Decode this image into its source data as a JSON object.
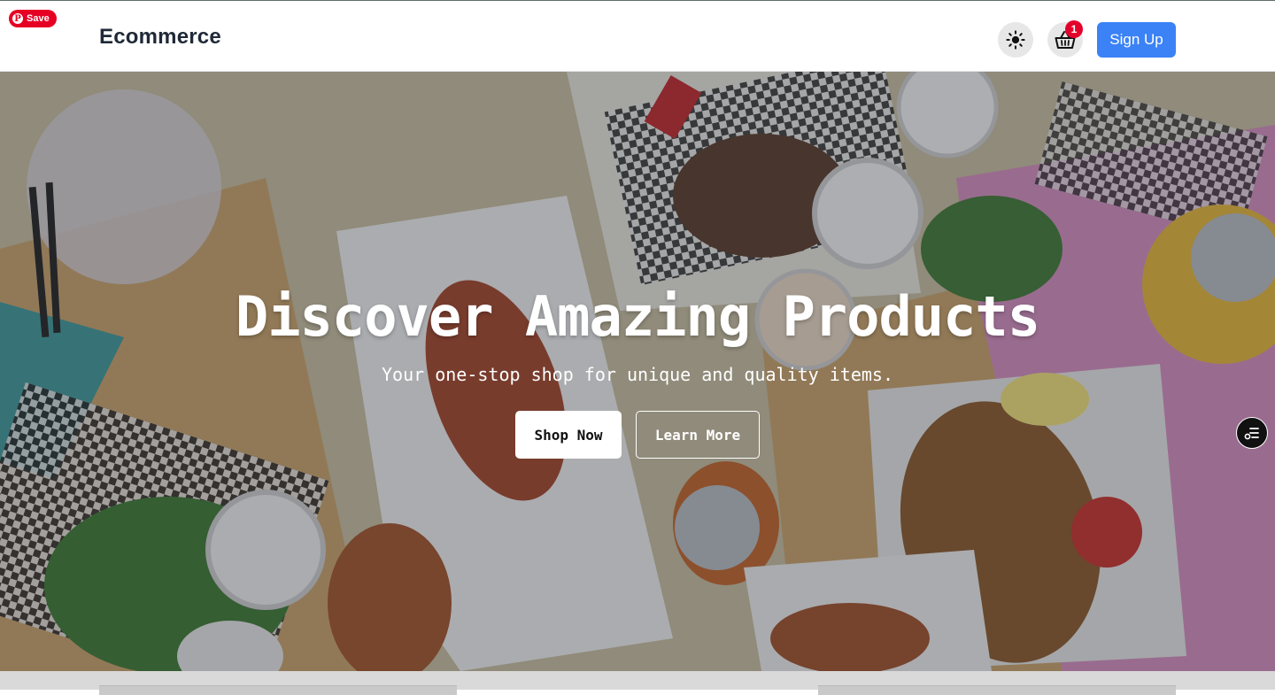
{
  "pinterest": {
    "save_label": "Save",
    "logo": "P"
  },
  "header": {
    "brand": "Ecommerce",
    "theme_toggle_icon": "sun-icon",
    "cart_icon": "basket-icon",
    "cart_count": "1",
    "signup_label": "Sign Up"
  },
  "hero": {
    "title": "Discover Amazing Products",
    "subtitle": "Your one-stop shop for unique and quality items.",
    "primary_button": "Shop Now",
    "secondary_button": "Learn More",
    "background": "food-table-photo"
  },
  "floating": {
    "icon": "filter-list-icon"
  },
  "colors": {
    "accent": "#3b82f6",
    "badge": "#e5002b",
    "pinterest": "#e60023",
    "brand_text": "#1f2937"
  }
}
